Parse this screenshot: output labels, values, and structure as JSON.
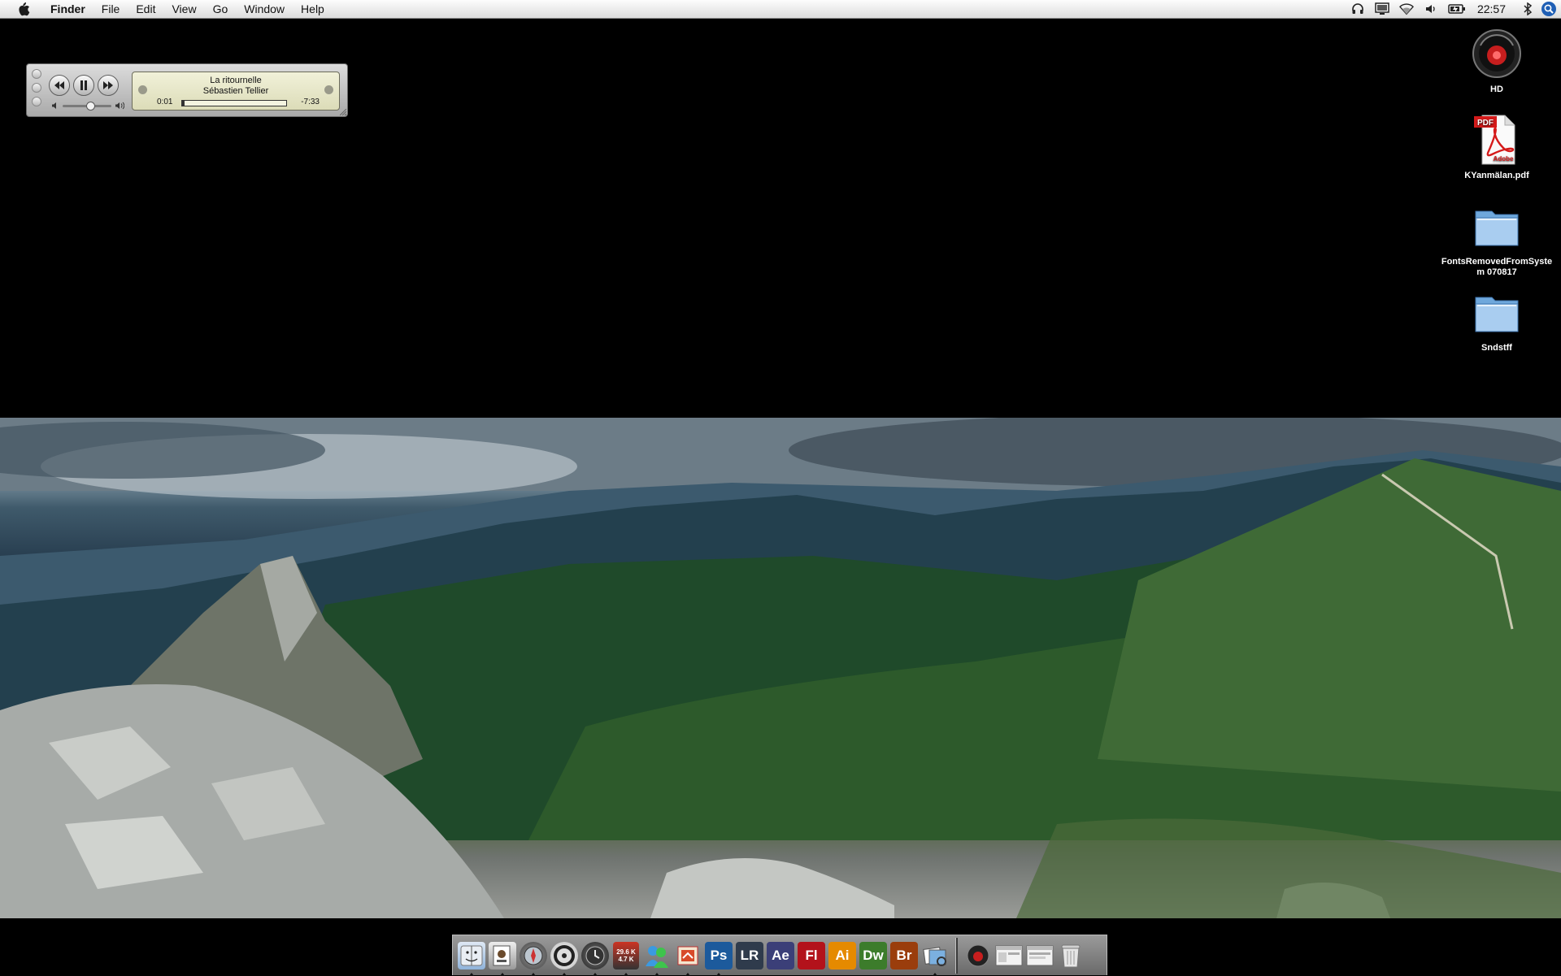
{
  "menubar": {
    "apple": "apple-logo-icon",
    "app": "Finder",
    "items": [
      "File",
      "Edit",
      "View",
      "Go",
      "Window",
      "Help"
    ],
    "status_icons": [
      "headphones-icon",
      "display-icon",
      "wifi-icon",
      "volume-icon",
      "battery-icon"
    ],
    "clock": "22:57",
    "spotlight": "spotlight-icon"
  },
  "mini_player": {
    "title": "La ritournelle",
    "artist": "Sébastien Tellier",
    "elapsed": "0:01",
    "remaining": "-7:33",
    "progress": 0.01,
    "volume": 0.55,
    "state": "playing"
  },
  "desktop_icons": [
    {
      "label": "HD",
      "icon": "hard-drive-icon"
    },
    {
      "label": "KYanmälan.pdf",
      "icon": "pdf-document-icon",
      "badge": "PDF",
      "brand": "Adobe"
    },
    {
      "label": "FontsRemovedFromSystem 070817",
      "icon": "folder-icon"
    },
    {
      "label": "Sndstff",
      "icon": "folder-icon"
    }
  ],
  "dock": {
    "netmon": {
      "down": "29.6 K",
      "up": "4.7 K"
    },
    "apps": [
      {
        "name": "finder",
        "running": true
      },
      {
        "name": "preview",
        "running": true
      },
      {
        "name": "safari",
        "running": true
      },
      {
        "name": "itunes",
        "running": true
      },
      {
        "name": "time-machine",
        "running": true
      },
      {
        "name": "network-monitor",
        "running": true
      },
      {
        "name": "messenger",
        "running": true
      },
      {
        "name": "mail",
        "running": true
      },
      {
        "name": "photoshop",
        "label": "Ps",
        "color": "#1c5a9c",
        "running": true
      },
      {
        "name": "lightroom",
        "label": "LR",
        "color": "#2f3b4c",
        "running": false
      },
      {
        "name": "after-effects",
        "label": "Ae",
        "color": "#3b3f78",
        "running": false
      },
      {
        "name": "flash",
        "label": "Fl",
        "color": "#b3121b",
        "running": false
      },
      {
        "name": "illustrator",
        "label": "Ai",
        "color": "#e58a00",
        "running": false
      },
      {
        "name": "dreamweaver",
        "label": "Dw",
        "color": "#3c7c2b",
        "running": false
      },
      {
        "name": "bridge",
        "label": "Br",
        "color": "#9a3d0c",
        "running": false
      },
      {
        "name": "preview-app",
        "running": true
      }
    ],
    "stacks": [
      "hd-stack",
      "window-stack-1",
      "window-stack-2",
      "trash"
    ]
  }
}
